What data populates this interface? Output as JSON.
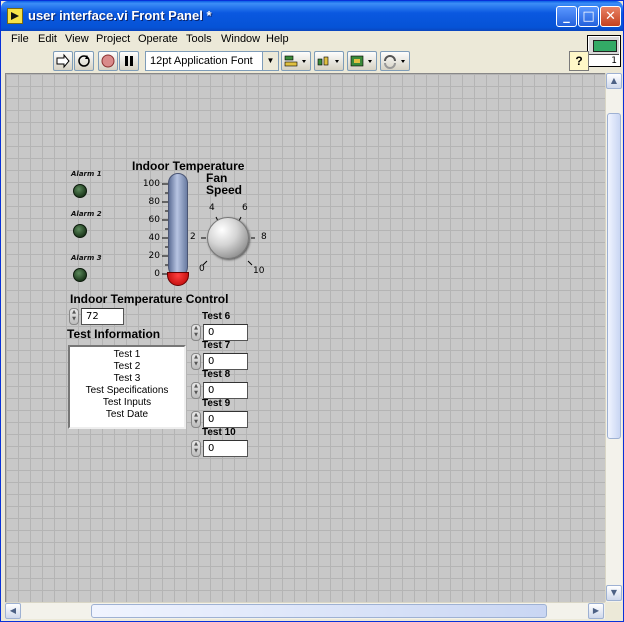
{
  "window": {
    "title": "user interface.vi Front Panel *"
  },
  "menu": [
    "File",
    "Edit",
    "View",
    "Project",
    "Operate",
    "Tools",
    "Window",
    "Help"
  ],
  "toolbar": {
    "font": "12pt Application Font",
    "help": "?",
    "icon_number": "1"
  },
  "alarms": [
    {
      "label": "Alarm 1"
    },
    {
      "label": "Alarm 2"
    },
    {
      "label": "Alarm 3"
    }
  ],
  "thermometer": {
    "label": "Indoor Temperature",
    "ticks": [
      "100",
      "80",
      "60",
      "40",
      "20",
      "0"
    ]
  },
  "fan_speed": {
    "label_line1": "Fan",
    "label_line2": "Speed",
    "scale": [
      "0",
      "2",
      "4",
      "6",
      "8",
      "10"
    ]
  },
  "temp_control": {
    "label": "Indoor Temperature Control",
    "value": "72"
  },
  "test_info": {
    "label": "Test Information",
    "items": [
      "Test 1",
      "Test 2",
      "Test 3",
      "Test Specifications",
      "Test Inputs",
      "Test Date"
    ]
  },
  "tests": [
    {
      "label": "Test 6",
      "value": "0"
    },
    {
      "label": "Test 7",
      "value": "0"
    },
    {
      "label": "Test 8",
      "value": "0"
    },
    {
      "label": "Test 9",
      "value": "0"
    },
    {
      "label": "Test 10",
      "value": "0"
    }
  ]
}
